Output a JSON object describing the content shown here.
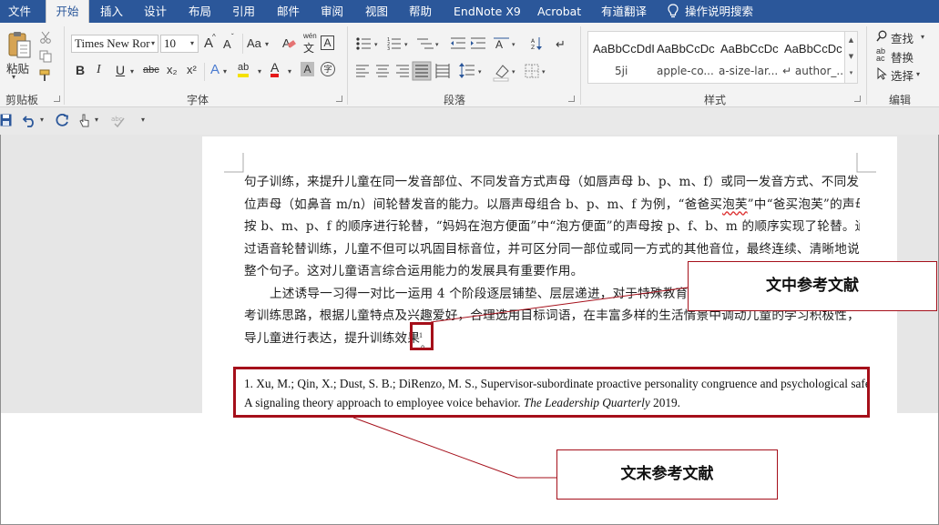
{
  "menu": {
    "tabs": [
      "文件",
      "开始",
      "插入",
      "设计",
      "布局",
      "引用",
      "邮件",
      "审阅",
      "视图",
      "帮助",
      "EndNote X9",
      "Acrobat",
      "有道翻译"
    ],
    "active": "开始",
    "tell_me": "操作说明搜索"
  },
  "ribbon": {
    "clipboard": {
      "paste": "粘贴",
      "label": "剪贴板"
    },
    "font": {
      "name": "Times New Ror",
      "size": "10",
      "grow": "A",
      "shrink": "A",
      "change_case": "Aa",
      "phonetic_top": "wén",
      "phonetic_char": "文",
      "border_char": "A",
      "bold": "B",
      "italic": "I",
      "underline": "U",
      "strike": "abc",
      "subscript": "x₂",
      "superscript": "x²",
      "effects": "A",
      "highlight": "ab",
      "color": "A",
      "shade": "A",
      "enclose": "字",
      "label": "字体"
    },
    "paragraph": {
      "label": "段落"
    },
    "styles": {
      "items": [
        {
          "sample": "AaBbCcDdI",
          "name": "5ji"
        },
        {
          "sample": "AaBbCcDc",
          "name": "apple-co..."
        },
        {
          "sample": "AaBbCcDc",
          "name": "a-size-lar..."
        },
        {
          "sample": "AaBbCcDc",
          "name": "↵ author_..."
        }
      ],
      "label": "样式"
    },
    "editing": {
      "find": "查找",
      "replace": "替换",
      "select": "选择",
      "label": "编辑"
    }
  },
  "document": {
    "lines": [
      "句子训练，来提升儿童在同一发音部位、不同发音方式声母（如唇声母 b、p、m、f）或同一发音方式、不同发音部",
      "位声母（如鼻音 m/n）间轮替发音的能力。以唇声母组合 b、p、m、f 为例，“爸爸买泡芙”中“爸买泡芙”的声母",
      "按 b、m、p、f 的顺序进行轮替，“妈妈在泡方便面”中“泡方便面”的声母按 p、f、b、m 的顺序实现了轮替。通",
      "过语音轮替训练，儿童不但可以巩固目标音位，并可区分同一部位或同一方式的其他音位，最终连续、清晰地说出",
      "整个句子。这对儿童语言综合运用能力的发展具有重要作用。",
      "上述诱导一习得一对比一运用 4 个阶段逐层铺垫、层层递进，对于特殊教育工",
      "考训练思路，根据儿童特点及兴趣爱好，合理选用目标词语，在丰富多样的生活情景中调动儿童的学习积极性，引",
      "导儿童进行表达，提升训练效果"
    ],
    "wavy_word": "泡芙",
    "citation_mark": "1",
    "citation_punct": "。",
    "reference": {
      "line1": "1. Xu, M.; Qin, X.; Dust, S. B.; DiRenzo, M. S., Supervisor-subordinate proactive personality congruence and psychological safety:",
      "line2_plain": "A signaling theory approach to employee voice behavior. ",
      "journal": "The Leadership Quarterly",
      "year": " 2019."
    }
  },
  "callouts": {
    "in_text": "文中参考文献",
    "end_text": "文末参考文献"
  },
  "colors": {
    "menubar": "#2b579a",
    "annotation": "#a50f1a"
  }
}
